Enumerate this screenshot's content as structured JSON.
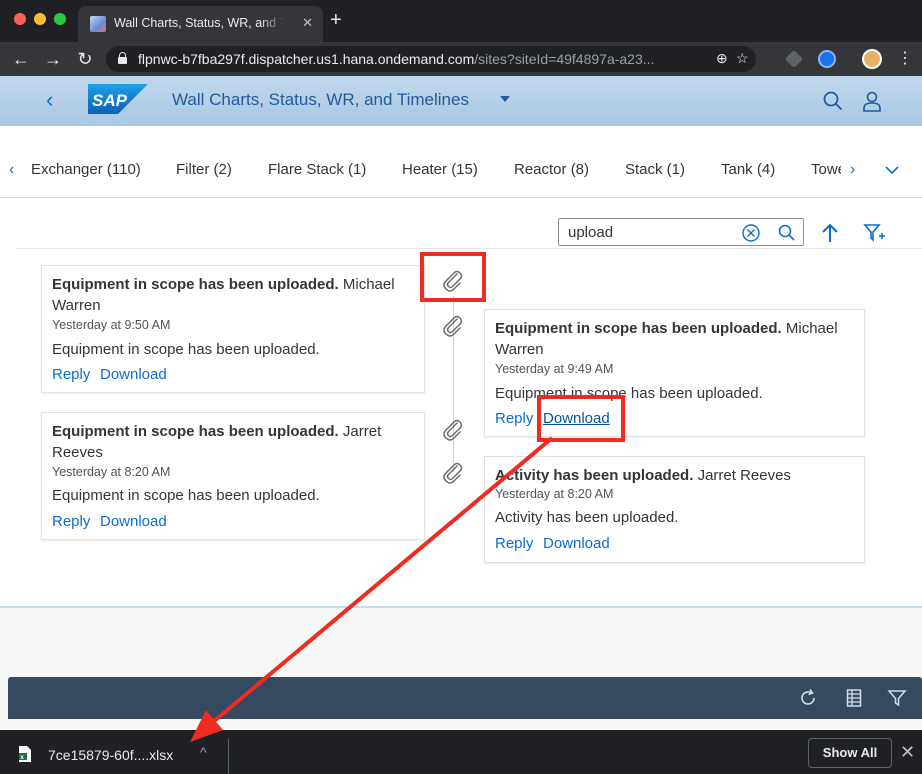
{
  "browser": {
    "tab_title": "Wall Charts, Status, WR, and Timelines",
    "url_host": "flpnwc-b7fba297f.dispatcher.us1.hana.ondemand.com",
    "url_path": "/sites?siteId=49f4897a-a23..."
  },
  "shell": {
    "app_title": "Wall Charts, Status, WR, and Timelines"
  },
  "categories": [
    "Exchanger (110)",
    "Filter (2)",
    "Flare Stack (1)",
    "Heater (15)",
    "Reactor (8)",
    "Stack (1)",
    "Tank (4)",
    "Towe"
  ],
  "search": {
    "value": "upload"
  },
  "timeline": [
    {
      "title": "Equipment in scope has been uploaded.",
      "author_line1": "Michael",
      "author_line2": "Warren",
      "time": "Yesterday at 9:50 AM",
      "body": "Equipment in scope has been uploaded.",
      "reply": "Reply",
      "download": "Download"
    },
    {
      "title": "Equipment in scope has been uploaded.",
      "author_line1": "Michael",
      "author_line2": "Warren",
      "time": "Yesterday at 9:49 AM",
      "body": "Equipment in scope has been uploaded.",
      "reply": "Reply",
      "download": "Download"
    },
    {
      "title": "Equipment in scope has been uploaded.",
      "author_line1": "Jarret",
      "author_line2": "Reeves",
      "time": "Yesterday at 8:20 AM",
      "body": "Equipment in scope has been uploaded.",
      "reply": "Reply",
      "download": "Download"
    },
    {
      "title": "Activity has been uploaded.",
      "author_line1": "Jarret Reeves",
      "author_line2": "",
      "time": "Yesterday at 8:20 AM",
      "body": "Activity has been uploaded.",
      "reply": "Reply",
      "download": "Download"
    }
  ],
  "download_shelf": {
    "file_name": "7ce15879-60f....xlsx",
    "show_all": "Show All"
  },
  "colors": {
    "annotation": "#ef2b22",
    "link": "#0a6ed1",
    "shell": "#a9c8e4",
    "footer_bar": "#354a5f"
  }
}
